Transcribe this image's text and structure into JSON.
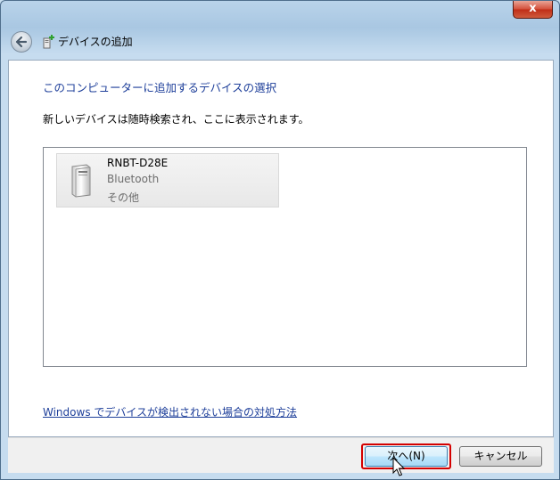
{
  "window": {
    "title": "デバイスの追加",
    "close_label": "x"
  },
  "content": {
    "heading": "このコンピューターに追加するデバイスの選択",
    "description": "新しいデバイスは随時検索され、ここに表示されます。",
    "devices": [
      {
        "name": "RNBT-D28E",
        "type": "Bluetooth",
        "category": "その他",
        "icon": "device-tower-icon"
      }
    ],
    "help_link": "Windows でデバイスが検出されない場合の対処方法"
  },
  "footer": {
    "next_label": "次へ(N)",
    "cancel_label": "キャンセル"
  }
}
